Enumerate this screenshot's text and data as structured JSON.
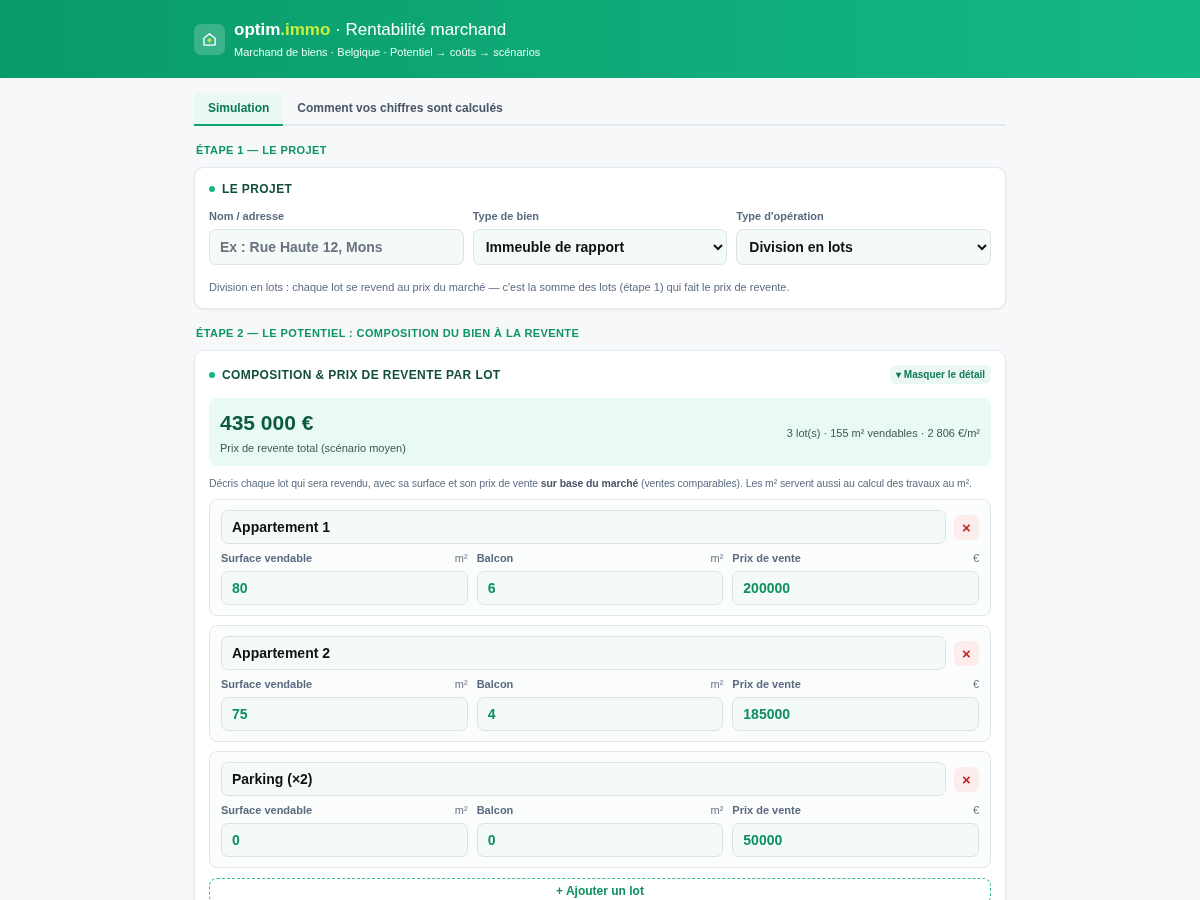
{
  "header": {
    "brand_main": "optim",
    "brand_accent": ".immo",
    "title": " · Rentabilité marchand",
    "subtitle": "Marchand de biens · Belgique · Potentiel → coûts → scénarios"
  },
  "tabs": [
    {
      "label": "Simulation",
      "selected": true
    },
    {
      "label": "Comment vos chiffres sont calculés",
      "selected": false
    }
  ],
  "step1": {
    "heading": "ÉTAPE 1 — LE PROJET",
    "card_title": "LE PROJET",
    "fields": [
      {
        "kind": "text",
        "label": "Nom / adresse",
        "placeholder": "Ex : Rue Haute 12, Mons"
      },
      {
        "kind": "select",
        "label": "Type de bien",
        "value": "Immeuble de rapport"
      },
      {
        "kind": "select",
        "label": "Type d'opération",
        "value": "Division en lots"
      }
    ],
    "note": "Division en lots : chaque lot se revend au prix du marché — c'est la somme des lots (étape 1) qui fait le prix de revente."
  },
  "step2": {
    "heading": "ÉTAPE 2 — LE POTENTIEL : COMPOSITION DU BIEN À LA REVENTE",
    "card_title": "COMPOSITION & PRIX DE REVENTE PAR LOT",
    "toggle": "▾ Masquer le détail",
    "total": "435 000 €",
    "total_label": "Prix de revente total (scénario moyen)",
    "summary": "3 lot(s) · 155 m² vendables · 2 806 €/m²",
    "intro": "Décris chaque lot qui sera revendu, avec sa surface et son prix de vente **sur base du marché** (ventes comparables). Les m² servent aussi au calcul des travaux au m².",
    "lots": [
      {
        "name": "Appartement 1",
        "delete": "×",
        "fields": [
          {
            "label": "Surface vendable",
            "unit": "m²",
            "value": "80"
          },
          {
            "label": "Balcon",
            "unit": "m²",
            "value": "6"
          },
          {
            "label": "Prix de vente",
            "unit": "€",
            "value": "200000"
          }
        ]
      },
      {
        "name": "Appartement 2",
        "delete": "×",
        "fields": [
          {
            "label": "Surface vendable",
            "unit": "m²",
            "value": "75"
          },
          {
            "label": "Balcon",
            "unit": "m²",
            "value": "4"
          },
          {
            "label": "Prix de vente",
            "unit": "€",
            "value": "185000"
          }
        ]
      },
      {
        "name": "Parking (×2)",
        "delete": "×",
        "fields": [
          {
            "label": "Surface vendable",
            "unit": "m²",
            "value": "0"
          },
          {
            "label": "Balcon",
            "unit": "m²",
            "value": "0"
          },
          {
            "label": "Prix de vente",
            "unit": "€",
            "value": "50000"
          }
        ]
      }
    ],
    "add": "+ Ajouter un lot"
  }
}
